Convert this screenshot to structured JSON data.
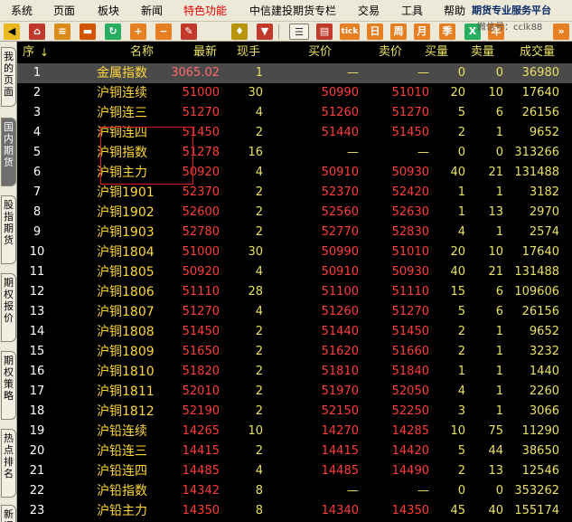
{
  "menu": {
    "items": [
      "系统",
      "页面",
      "板块",
      "新闻",
      "特色功能",
      "中信建投期货专栏",
      "交易",
      "工具",
      "帮助"
    ],
    "active": "特色功能"
  },
  "brand": {
    "title": "期货专业服务平台",
    "wechat": "微信号：cclk88"
  },
  "toolbar": {
    "icons": [
      "back-icon",
      "home-icon",
      "stack-icon",
      "tag-icon",
      "refresh-icon",
      "zoom-in-icon",
      "zoom-out-icon",
      "pencil-icon",
      "bell-icon",
      "filter-icon",
      "list-icon",
      "chart-icon",
      "tick-icon",
      "day-icon",
      "week-icon",
      "month-icon",
      "season-icon",
      "excel-icon",
      "year-icon",
      "more-icon"
    ],
    "labels": {
      "tick": "tick",
      "day": "日",
      "week": "周",
      "month": "月",
      "season": "季",
      "excel": "X",
      "year": "年"
    }
  },
  "side_tabs": [
    {
      "label": "我的页面",
      "active": false
    },
    {
      "label": "国内期货",
      "active": true
    },
    {
      "label": "股指期货",
      "active": false
    },
    {
      "label": "期权报价",
      "active": false
    },
    {
      "label": "期权策略",
      "active": false
    },
    {
      "label": "热点排名",
      "active": false
    },
    {
      "label": "新闻",
      "active": false
    }
  ],
  "table": {
    "headers": {
      "seq": "序",
      "sort_arrow": "↓",
      "name": "名称",
      "latest": "最新",
      "volume": "现手",
      "bid": "买价",
      "ask": "卖价",
      "bid_qty": "买量",
      "ask_qty": "卖量",
      "total": "成交量"
    },
    "rows": [
      {
        "seq": "1",
        "name": "金属指数",
        "latest": "3065.02",
        "vol": "1",
        "bid": "—",
        "ask": "—",
        "bq": "0",
        "aq": "0",
        "tot": "36980"
      },
      {
        "seq": "2",
        "name": "沪铜连续",
        "latest": "51000",
        "vol": "30",
        "bid": "50990",
        "ask": "51010",
        "bq": "20",
        "aq": "10",
        "tot": "17640"
      },
      {
        "seq": "3",
        "name": "沪铜连三",
        "latest": "51270",
        "vol": "4",
        "bid": "51260",
        "ask": "51270",
        "bq": "5",
        "aq": "6",
        "tot": "26156"
      },
      {
        "seq": "4",
        "name": "沪铜连四",
        "latest": "51450",
        "vol": "2",
        "bid": "51440",
        "ask": "51450",
        "bq": "2",
        "aq": "1",
        "tot": "9652"
      },
      {
        "seq": "5",
        "name": "沪铜指数",
        "latest": "51278",
        "vol": "16",
        "bid": "—",
        "ask": "—",
        "bq": "0",
        "aq": "0",
        "tot": "313266"
      },
      {
        "seq": "6",
        "name": "沪铜主力",
        "latest": "50920",
        "vol": "4",
        "bid": "50910",
        "ask": "50930",
        "bq": "40",
        "aq": "21",
        "tot": "131488"
      },
      {
        "seq": "7",
        "name": "沪铜1901",
        "latest": "52370",
        "vol": "2",
        "bid": "52370",
        "ask": "52420",
        "bq": "1",
        "aq": "1",
        "tot": "3182"
      },
      {
        "seq": "8",
        "name": "沪铜1902",
        "latest": "52600",
        "vol": "2",
        "bid": "52560",
        "ask": "52630",
        "bq": "1",
        "aq": "13",
        "tot": "2970"
      },
      {
        "seq": "9",
        "name": "沪铜1903",
        "latest": "52780",
        "vol": "2",
        "bid": "52770",
        "ask": "52830",
        "bq": "4",
        "aq": "1",
        "tot": "2574"
      },
      {
        "seq": "10",
        "name": "沪铜1804",
        "latest": "51000",
        "vol": "30",
        "bid": "50990",
        "ask": "51010",
        "bq": "20",
        "aq": "10",
        "tot": "17640"
      },
      {
        "seq": "11",
        "name": "沪铜1805",
        "latest": "50920",
        "vol": "4",
        "bid": "50910",
        "ask": "50930",
        "bq": "40",
        "aq": "21",
        "tot": "131488"
      },
      {
        "seq": "12",
        "name": "沪铜1806",
        "latest": "51110",
        "vol": "28",
        "bid": "51100",
        "ask": "51110",
        "bq": "15",
        "aq": "6",
        "tot": "109606"
      },
      {
        "seq": "13",
        "name": "沪铜1807",
        "latest": "51270",
        "vol": "4",
        "bid": "51260",
        "ask": "51270",
        "bq": "5",
        "aq": "6",
        "tot": "26156"
      },
      {
        "seq": "14",
        "name": "沪铜1808",
        "latest": "51450",
        "vol": "2",
        "bid": "51440",
        "ask": "51450",
        "bq": "2",
        "aq": "1",
        "tot": "9652"
      },
      {
        "seq": "15",
        "name": "沪铜1809",
        "latest": "51650",
        "vol": "2",
        "bid": "51620",
        "ask": "51660",
        "bq": "2",
        "aq": "1",
        "tot": "3232"
      },
      {
        "seq": "16",
        "name": "沪铜1810",
        "latest": "51820",
        "vol": "2",
        "bid": "51810",
        "ask": "51840",
        "bq": "1",
        "aq": "1",
        "tot": "1440"
      },
      {
        "seq": "17",
        "name": "沪铜1811",
        "latest": "52010",
        "vol": "2",
        "bid": "51970",
        "ask": "52050",
        "bq": "4",
        "aq": "1",
        "tot": "2260"
      },
      {
        "seq": "18",
        "name": "沪铜1812",
        "latest": "52190",
        "vol": "2",
        "bid": "52150",
        "ask": "52250",
        "bq": "3",
        "aq": "1",
        "tot": "3066"
      },
      {
        "seq": "19",
        "name": "沪铅连续",
        "latest": "14265",
        "vol": "10",
        "bid": "14270",
        "ask": "14285",
        "bq": "10",
        "aq": "75",
        "tot": "11290"
      },
      {
        "seq": "20",
        "name": "沪铅连三",
        "latest": "14415",
        "vol": "2",
        "bid": "14415",
        "ask": "14420",
        "bq": "5",
        "aq": "44",
        "tot": "38650"
      },
      {
        "seq": "21",
        "name": "沪铅连四",
        "latest": "14485",
        "vol": "4",
        "bid": "14485",
        "ask": "14490",
        "bq": "2",
        "aq": "13",
        "tot": "12546"
      },
      {
        "seq": "22",
        "name": "沪铅指数",
        "latest": "14342",
        "vol": "8",
        "bid": "—",
        "ask": "—",
        "bq": "0",
        "aq": "0",
        "tot": "353262"
      },
      {
        "seq": "23",
        "name": "沪铅主力",
        "latest": "14350",
        "vol": "8",
        "bid": "14340",
        "ask": "14350",
        "bq": "45",
        "aq": "40",
        "tot": "155174"
      }
    ]
  },
  "colors": {
    "background": "#000000",
    "header_text": "#e9e064",
    "name_text": "#ffd73a",
    "price_up": "#ff3c3c",
    "selected_row": "#4a4a4a",
    "highlight_box": "#e01818",
    "menu_active": "#e00000"
  }
}
